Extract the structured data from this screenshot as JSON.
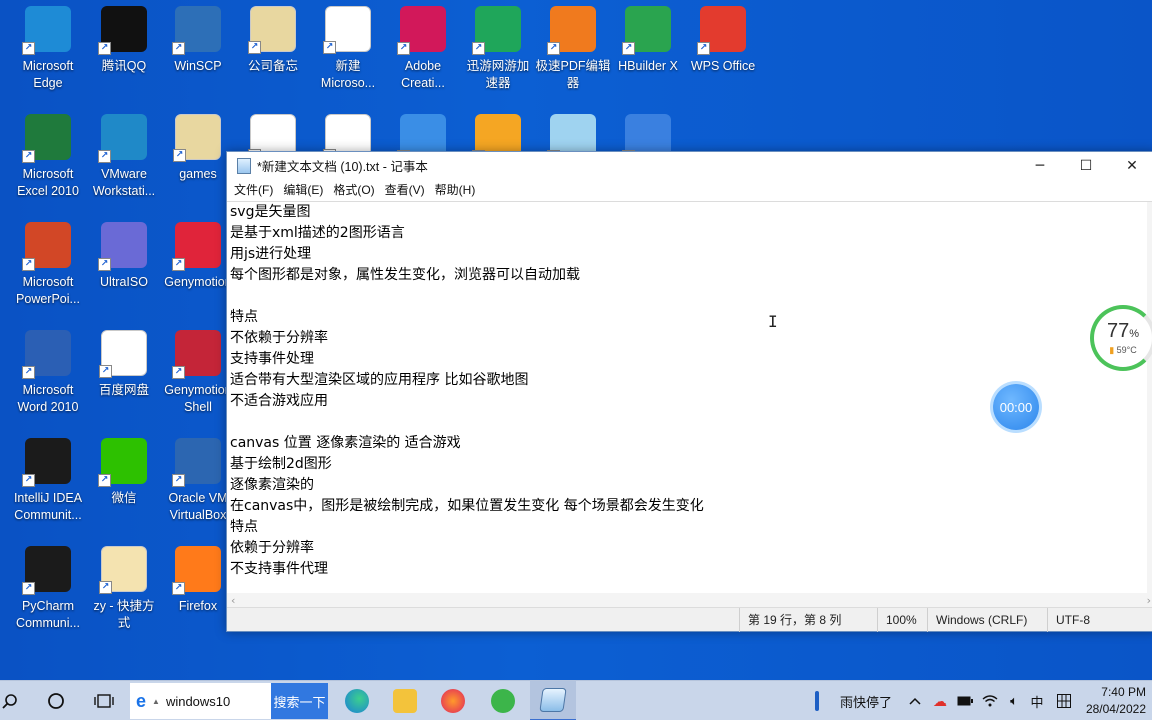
{
  "desktop": {
    "icons": [
      {
        "label": "Microsoft\nEdge",
        "icon": "edge-icon",
        "color": "#1e8bd6"
      },
      {
        "label": "腾讯QQ",
        "icon": "qq-penguin-icon",
        "color": "#111111"
      },
      {
        "label": "WinSCP",
        "icon": "winscp-lock-icon",
        "color": "#2d6fb7"
      },
      {
        "label": "公司备忘",
        "icon": "folder-icon",
        "color": "#e8d7a0"
      },
      {
        "label": "新建\nMicroso...",
        "icon": "excel-doc-icon",
        "color": "#ffffff"
      },
      {
        "label": "Adobe\nCreati...",
        "icon": "adobe-cc-icon",
        "color": "#d2185a"
      },
      {
        "label": "迅游网游加\n速器",
        "icon": "xunyou-icon",
        "color": "#1fa65a"
      },
      {
        "label": "极速PDF编辑\n器",
        "icon": "pdf-editor-icon",
        "color": "#f07a1e"
      },
      {
        "label": "HBuilder X",
        "icon": "hbuilder-icon",
        "color": "#2aa44f"
      },
      {
        "label": "WPS Office",
        "icon": "wps-icon",
        "color": "#e33b2e"
      },
      {
        "label": "Microsoft\nExcel 2010",
        "icon": "excel-icon",
        "color": "#1f7a3c"
      },
      {
        "label": "VMware\nWorkstati...",
        "icon": "vmware-icon",
        "color": "#1f89c8"
      },
      {
        "label": "games",
        "icon": "folder-icon",
        "color": "#e8d7a0"
      },
      {
        "label": "",
        "icon": "word-doc-icon",
        "color": "#ffffff"
      },
      {
        "label": "",
        "icon": "word-doc-icon",
        "color": "#ffffff"
      },
      {
        "label": "",
        "icon": "prism-icon",
        "color": "#3a8ee6"
      },
      {
        "label": "",
        "icon": "flame-icon",
        "color": "#f5a623"
      },
      {
        "label": "",
        "icon": "ev-recorder-icon",
        "color": "#9fd3f0"
      },
      {
        "label": "",
        "icon": "zip-icon",
        "color": "#3a80e0"
      },
      {
        "label": "Microsoft\nPowerPoi...",
        "icon": "powerpoint-icon",
        "color": "#d24726"
      },
      {
        "label": "UltraISO",
        "icon": "disc-icon",
        "color": "#6a6ad6"
      },
      {
        "label": "Genymotion",
        "icon": "genymotion-icon",
        "color": "#e0243a"
      },
      {
        "label": "Microsoft\nWord 2010",
        "icon": "word-icon",
        "color": "#2b5fb4"
      },
      {
        "label": "百度网盘",
        "icon": "baidu-netdisk-icon",
        "color": "#ffffff"
      },
      {
        "label": "Genymotion\nShell",
        "icon": "genymotion-shell-icon",
        "color": "#c42538"
      },
      {
        "label": "IntelliJ IDEA\nCommunit...",
        "icon": "intellij-icon",
        "color": "#1b1b1b"
      },
      {
        "label": "微信",
        "icon": "wechat-icon",
        "color": "#2dc100"
      },
      {
        "label": "Oracle VM\nVirtualBox",
        "icon": "virtualbox-icon",
        "color": "#2c66b1"
      },
      {
        "label": "PyCharm\nCommuni...",
        "icon": "pycharm-icon",
        "color": "#1b1b1b"
      },
      {
        "label": "zy - 快捷方\n式",
        "icon": "pdf-file-icon",
        "color": "#f4e3b0"
      },
      {
        "label": "Firefox",
        "icon": "firefox-icon",
        "color": "#ff7a1a"
      }
    ]
  },
  "notepad": {
    "title": "*新建文本文档 (10).txt - 记事本",
    "window_controls": {
      "minimize": "─",
      "maximize": "☐",
      "close": "✕"
    },
    "menu": [
      "文件(F)",
      "编辑(E)",
      "格式(O)",
      "查看(V)",
      "帮助(H)"
    ],
    "lines": [
      "svg是矢量图",
      "是基于xml描述的2图形语言",
      "用js进行处理",
      "每个图形都是对象，属性发生变化，浏览器可以自动加载",
      "",
      "特点",
      "不依赖于分辨率",
      "支持事件处理",
      "适合带有大型渲染区域的应用程序 比如谷歌地图",
      "不适合游戏应用",
      "",
      "canvas 位置 逐像素渲染的 适合游戏",
      "基于绘制2d图形",
      "逐像素渲染的",
      "在canvas中，图形是被绘制完成，如果位置发生变化 每个场景都会发生变化",
      "特点",
      "依赖于分辨率",
      "不支持事件代理"
    ],
    "status": {
      "position": "第 19 行，第 8 列",
      "zoom": "100%",
      "line_ending": "Windows (CRLF)",
      "encoding": "UTF-8"
    }
  },
  "widgets": {
    "timer": "00:00",
    "monitor": {
      "percent": "77",
      "percent_sign": "%",
      "temperature": "59°C"
    }
  },
  "taskbar": {
    "search_text": "windows10",
    "search_button": "搜索一下",
    "weather": "雨快停了",
    "ime": "中",
    "time": "7:40 PM",
    "date": "28/04/2022"
  }
}
